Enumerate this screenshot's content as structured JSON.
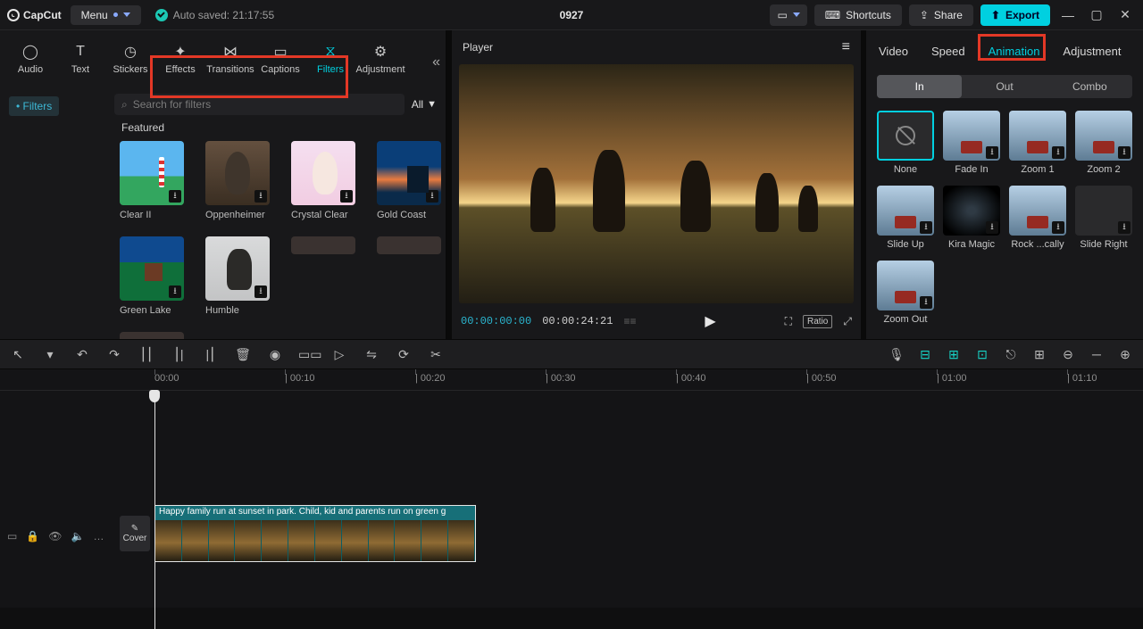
{
  "topbar": {
    "app_name": "CapCut",
    "menu_label": "Menu",
    "autosave_text": "Auto saved: 21:17:55",
    "project_title": "0927",
    "shortcuts_label": "Shortcuts",
    "share_label": "Share",
    "export_label": "Export"
  },
  "tool_tabs": [
    {
      "id": "audio",
      "label": "Audio",
      "icon": "◯"
    },
    {
      "id": "text",
      "label": "Text",
      "icon": "T"
    },
    {
      "id": "stickers",
      "label": "Stickers",
      "icon": "◷"
    },
    {
      "id": "effects",
      "label": "Effects",
      "icon": "✦"
    },
    {
      "id": "transitions",
      "label": "Transitions",
      "icon": "⋈"
    },
    {
      "id": "captions",
      "label": "Captions",
      "icon": "▭"
    },
    {
      "id": "filters",
      "label": "Filters",
      "icon": "⧖",
      "active": true
    },
    {
      "id": "adjustment",
      "label": "Adjustment",
      "icon": "⚙"
    }
  ],
  "sidebar_chip": "Filters",
  "search_placeholder": "Search for filters",
  "all_label": "All",
  "featured_label": "Featured",
  "filter_thumbs": [
    {
      "id": "clear2",
      "label": "Clear II",
      "cls": "t-lighthouse"
    },
    {
      "id": "oppenheimer",
      "label": "Oppenheimer",
      "cls": "t-opp"
    },
    {
      "id": "crystal",
      "label": "Crystal Clear",
      "cls": "t-crystal"
    },
    {
      "id": "goldcoast",
      "label": "Gold Coast",
      "cls": "t-gold"
    },
    {
      "id": "greenlake",
      "label": "Green Lake",
      "cls": "t-green"
    },
    {
      "id": "humble",
      "label": "Humble",
      "cls": "t-humble"
    }
  ],
  "player": {
    "title": "Player",
    "current_tc": "00:00:00:00",
    "duration_tc": "00:00:24:21",
    "ratio_label": "Ratio"
  },
  "right_panel_tabs": [
    {
      "id": "video",
      "label": "Video"
    },
    {
      "id": "speed",
      "label": "Speed"
    },
    {
      "id": "animation",
      "label": "Animation",
      "active": true
    },
    {
      "id": "adjustment",
      "label": "Adjustment"
    }
  ],
  "anim_segments": [
    {
      "id": "in",
      "label": "In",
      "active": true
    },
    {
      "id": "out",
      "label": "Out"
    },
    {
      "id": "combo",
      "label": "Combo"
    }
  ],
  "animations": [
    {
      "id": "none",
      "label": "None",
      "variant": "none",
      "selected": true
    },
    {
      "id": "fadein",
      "label": "Fade In",
      "variant": "sky"
    },
    {
      "id": "zoom1",
      "label": "Zoom 1",
      "variant": "sky"
    },
    {
      "id": "zoom2",
      "label": "Zoom 2",
      "variant": "sky"
    },
    {
      "id": "slideup",
      "label": "Slide Up",
      "variant": "sky"
    },
    {
      "id": "kira",
      "label": "Kira Magic",
      "variant": "dark"
    },
    {
      "id": "rock",
      "label": "Rock ...cally",
      "variant": "sky"
    },
    {
      "id": "slideright",
      "label": "Slide Right",
      "variant": "plain"
    },
    {
      "id": "zoomout",
      "label": "Zoom Out",
      "variant": "sky"
    }
  ],
  "timeline_toolbar_left": [
    "↖",
    "▾",
    "↶",
    "↷",
    "⎮⎮",
    "⎮|",
    "|⎮",
    "🗑",
    "◉",
    "▭▭",
    "▷",
    "⇋",
    "⟳",
    "✂"
  ],
  "timeline_toolbar_right": [
    "🎙",
    "⊟",
    "⊞",
    "⊡",
    "⎋",
    "⊞",
    "⊖",
    "─",
    "⊕"
  ],
  "ruler_ticks": [
    "00:00",
    "| 00:10",
    "| 00:20",
    "| 00:30",
    "| 00:40",
    "| 00:50",
    "| 01:00",
    "| 01:10"
  ],
  "cover_label": "Cover",
  "clip_title": "Happy family run at sunset in park. Child, kid and parents run on green g",
  "track_icons": [
    "▭",
    "🔒",
    "👁",
    "🔈",
    "…"
  ]
}
